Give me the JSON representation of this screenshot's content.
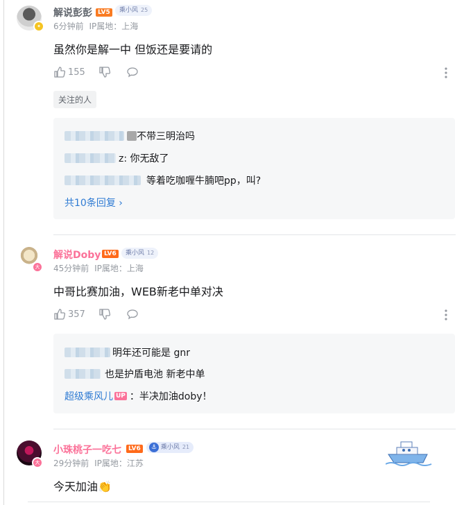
{
  "comments": [
    {
      "username": "解说彭彭",
      "level": "LV5",
      "fan_badge": {
        "name": "乘小风",
        "level": "25"
      },
      "time": "6分钟前",
      "ip": "IP属地：上海",
      "text": "虽然你是解一中 但饭还是要请的",
      "likes": "155",
      "tag": "关注的人",
      "replies": [
        {
          "text": "不带三明治吗"
        },
        {
          "text": "z: 你无敌了"
        },
        {
          "text": "等着吃咖喱牛腩吧pp，叫?"
        }
      ],
      "replies_link": "共10条回复 ›"
    },
    {
      "username": "解说Doby",
      "level": "LV6",
      "fan_badge": {
        "name": "乘小风",
        "level": "12"
      },
      "time": "45分钟前",
      "ip": "IP属地：上海",
      "text": "中哥比赛加油，WEB新老中单对决",
      "likes": "357",
      "replies": [
        {
          "text": "明年还可能是 gnr"
        },
        {
          "text": "也是护盾电池 新老中单"
        },
        {
          "author": "超级乘风儿",
          "up": "UP",
          "text": "：半决加油doby！"
        }
      ]
    },
    {
      "username": "小珠桃子一吃七",
      "level": "LV6",
      "fan_badge": {
        "name": "乘小风",
        "level": "21"
      },
      "time": "29分钟前",
      "ip": "IP属地：江苏",
      "text": "今天加油👏"
    }
  ],
  "colors": {
    "pink_username": "#fb7299",
    "level_orange": "#f97b22",
    "link_blue": "#2f7bd3"
  }
}
